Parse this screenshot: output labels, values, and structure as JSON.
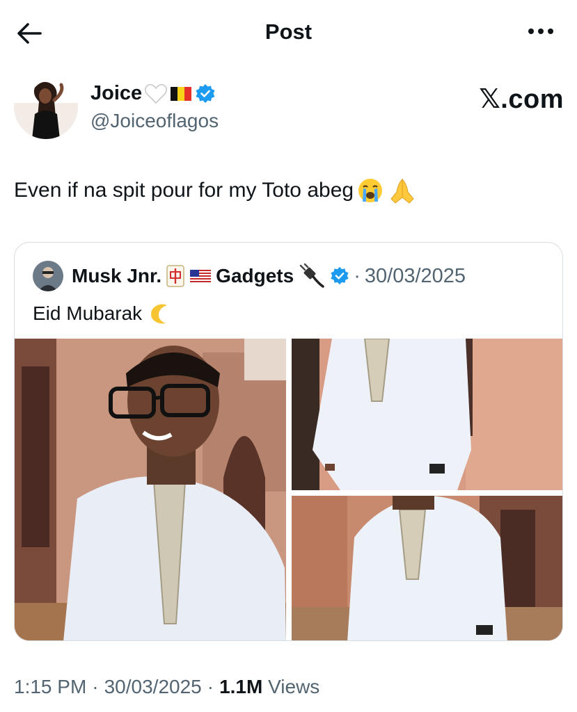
{
  "header": {
    "title": "Post",
    "back_icon": "arrow-left-icon",
    "more_icon": "more-horizontal-icon"
  },
  "author": {
    "display_name": "Joice",
    "emojis": [
      "white-heart",
      "belgium-flag"
    ],
    "verified": true,
    "handle": "@Joiceoflagos"
  },
  "watermark": "𝕏.com",
  "post": {
    "text": "Even if na spit pour for my Toto abeg",
    "emojis": [
      "crying-face",
      "folded-hands"
    ]
  },
  "quote": {
    "display_name": "Musk Jnr.",
    "name_suffix": "Gadgets",
    "name_emojis": [
      "mahjong-tile",
      "us-flag",
      "electric-plug"
    ],
    "verified": true,
    "separator": "·",
    "date": "30/03/2025",
    "text": "Eid Mubarak",
    "text_emoji": "crescent-moon",
    "photos": [
      "portrait-smiling-man-in-white-kaftan",
      "torso-white-kaftan-front",
      "white-kaftan-full-front"
    ]
  },
  "meta": {
    "time": "1:15 PM",
    "separator": "·",
    "date": "30/03/2025",
    "views_count": "1.1M",
    "views_label": "Views"
  },
  "colors": {
    "text": "#0f1419",
    "secondary": "#536471",
    "verified": "#1d9bf0",
    "border": "#d5dce2"
  }
}
